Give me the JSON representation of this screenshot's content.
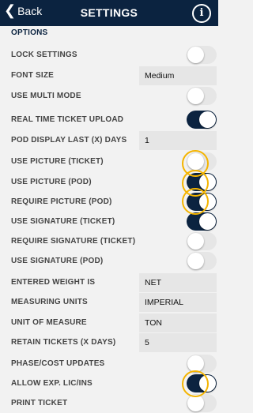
{
  "header": {
    "back_label": "Back",
    "title": "SETTINGS",
    "info_glyph": "i",
    "bg_color": "#0b2340"
  },
  "section": {
    "label": "OPTIONS"
  },
  "settings": [
    {
      "label": "LOCK SETTINGS",
      "type": "toggle",
      "on": false
    },
    {
      "label": "FONT SIZE",
      "type": "value",
      "value": "Medium"
    },
    {
      "label": "USE MULTI MODE",
      "type": "toggle",
      "on": false
    },
    {
      "label": "REAL TIME TICKET UPLOAD",
      "type": "toggle",
      "on": true
    },
    {
      "label": "POD DISPLAY LAST (X) DAYS",
      "type": "value",
      "value": "1"
    },
    {
      "label": "USE PICTURE (TICKET)",
      "type": "toggle",
      "on": false
    },
    {
      "label": "USE PICTURE (POD)",
      "type": "toggle",
      "on": true
    },
    {
      "label": "REQUIRE PICTURE (POD)",
      "type": "toggle",
      "on": true
    },
    {
      "label": "USE SIGNATURE (TICKET)",
      "type": "toggle",
      "on": true
    },
    {
      "label": "REQUIRE SIGNATURE (TICKET)",
      "type": "toggle",
      "on": false
    },
    {
      "label": "USE SIGNATURE (POD)",
      "type": "toggle",
      "on": false
    },
    {
      "label": "ENTERED WEIGHT IS",
      "type": "value",
      "value": "NET"
    },
    {
      "label": "MEASURING UNITS",
      "type": "value",
      "value": "IMPERIAL"
    },
    {
      "label": "UNIT OF MEASURE",
      "type": "value",
      "value": "TON"
    },
    {
      "label": "RETAIN TICKETS (X DAYS)",
      "type": "value",
      "value": "5"
    },
    {
      "label": "PHASE/COST UPDATES",
      "type": "toggle",
      "on": false
    },
    {
      "label": "ALLOW EXP. LIC/INS",
      "type": "toggle",
      "on": true
    },
    {
      "label": "PRINT TICKET",
      "type": "toggle",
      "on": false
    }
  ],
  "highlight_color": "#f4b400"
}
